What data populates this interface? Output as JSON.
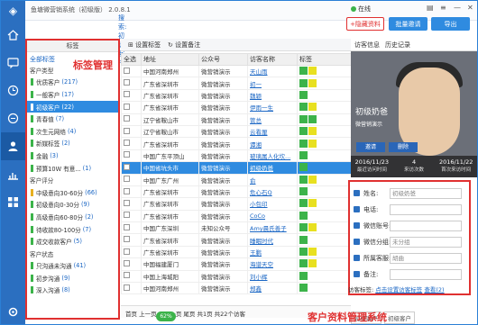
{
  "app": {
    "title": "鱼塘微营销系统（初级版） 2.0.8.1",
    "status": "在线",
    "search_text": "搜索: 初级客户"
  },
  "toolbar": {
    "collapse_label": "+隐藏资料",
    "batch_label": "批量邀请",
    "export_label": "导出"
  },
  "tag_panel": {
    "header": "标签",
    "all_tags": "全部标签",
    "annotation": "标签管理",
    "rows": [
      {
        "type": "cat",
        "label": "客户类型"
      },
      {
        "type": "tag",
        "label": "优质客户",
        "count": "(217)",
        "color": "#3cb34a"
      },
      {
        "type": "tag",
        "label": "一般客户",
        "count": "(17)",
        "color": "#3cb34a"
      },
      {
        "type": "tag",
        "label": "初级客户",
        "count": "(22)",
        "color": "#ffffff",
        "selected": true
      },
      {
        "type": "tag",
        "label": "青春值",
        "count": "(7)",
        "color": "#3cb34a"
      },
      {
        "type": "tag",
        "label": "次生元网络",
        "count": "(4)",
        "color": "#3cb34a"
      },
      {
        "type": "tag",
        "label": "新媒标签",
        "count": "(2)",
        "color": "#3cb34a"
      },
      {
        "type": "tag",
        "label": "金融",
        "count": "(3)",
        "color": "#3cb34a"
      },
      {
        "type": "tag",
        "label": "预算10W 有意...",
        "count": "(1)",
        "color": "#3cb34a"
      },
      {
        "type": "cat",
        "label": "客户评分"
      },
      {
        "type": "tag",
        "label": "中级意向30-60分",
        "count": "(66)",
        "color": "#e8b020"
      },
      {
        "type": "tag",
        "label": "初级意向0-30分",
        "count": "(9)",
        "color": "#3cb34a"
      },
      {
        "type": "tag",
        "label": "高级意向60-80分",
        "count": "(2)",
        "color": "#3cb34a"
      },
      {
        "type": "tag",
        "label": "待收款80-100分",
        "count": "(7)",
        "color": "#3cb34a"
      },
      {
        "type": "tag",
        "label": "成交收款客户",
        "count": "(5)",
        "color": "#3cb34a"
      },
      {
        "type": "cat",
        "label": "客户状态"
      },
      {
        "type": "tag",
        "label": "只沟通未沟通",
        "count": "(41)",
        "color": "#3cb34a"
      },
      {
        "type": "tag",
        "label": "初步沟通",
        "count": "(9)",
        "color": "#3cb34a"
      },
      {
        "type": "tag",
        "label": "深入沟通",
        "count": "(8)",
        "color": "#3cb34a"
      }
    ]
  },
  "grid": {
    "tool_set_tag": "设置标签",
    "tool_set_group": "设置备注",
    "columns": [
      "全选",
      "地址",
      "公众号",
      "访客名称",
      "标签"
    ],
    "rows": [
      {
        "addr": "中国河南郑州",
        "account": "微营销演示",
        "name": "天山雨",
        "tags": [
          "#3cb34a",
          "#e8e020"
        ]
      },
      {
        "addr": "广东省深圳市",
        "account": "微营销演示",
        "name": "初一",
        "tags": [
          "#3cb34a",
          "#e8e020"
        ]
      },
      {
        "addr": "广东省深圳市",
        "account": "微营销演示",
        "name": "魏颖",
        "tags": [
          "#3cb34a"
        ]
      },
      {
        "addr": "广东省深圳市",
        "account": "微营销演示",
        "name": "伊雨一生",
        "tags": [
          "#3cb34a",
          "#e8e020"
        ]
      },
      {
        "addr": "辽宁省鞍山市",
        "account": "微营销演示",
        "name": "管总",
        "tags": [
          "#3cb34a",
          "#3cb34a"
        ]
      },
      {
        "addr": "辽宁省鞍山市",
        "account": "微营销演示",
        "name": "云看厘",
        "tags": [
          "#3cb34a",
          "#e8e020"
        ]
      },
      {
        "addr": "广东省深圳市",
        "account": "微营销演示",
        "name": "谭湘",
        "tags": [
          "#3cb34a",
          "#e8e020"
        ]
      },
      {
        "addr": "中国广东平顶山",
        "account": "微营销演示",
        "name": "玻璃属人化坎...",
        "tags": [
          "#3cb34a"
        ]
      },
      {
        "addr": "中国省坑头市",
        "account": "微营销演示",
        "name": "初级奶爸",
        "tags": [
          "#3cb34a"
        ],
        "selected": true
      },
      {
        "addr": "中国广东广州",
        "account": "微营销演示",
        "name": "俞",
        "tags": [
          "#3cb34a",
          "#e8e020"
        ]
      },
      {
        "addr": "广东省深圳市",
        "account": "微营销演示",
        "name": "危心石Q",
        "tags": [
          "#3cb34a"
        ]
      },
      {
        "addr": "广东省深圳市",
        "account": "微营销演示",
        "name": "小包印",
        "tags": [
          "#3cb34a",
          "#e8e020"
        ]
      },
      {
        "addr": "广东省深圳市",
        "account": "微营销演示",
        "name": "CoCo",
        "tags": [
          "#3cb34a"
        ]
      },
      {
        "addr": "中国广东深圳",
        "account": "未知公众号",
        "name": "Amy晨氏善子",
        "tags": [
          "#3cb34a",
          "#e8e020"
        ]
      },
      {
        "addr": "广东省深圳市",
        "account": "微营销演示",
        "name": "睡眠时代",
        "tags": [
          "#3cb34a"
        ]
      },
      {
        "addr": "广东省深圳市",
        "account": "微营销演示",
        "name": "王鹏",
        "tags": [
          "#3cb34a",
          "#e8e020"
        ]
      },
      {
        "addr": "中国福建厦门",
        "account": "微营销演示",
        "name": "海谱天空",
        "tags": [
          "#3cb34a",
          "#e8e020"
        ]
      },
      {
        "addr": "中国上海城阳",
        "account": "微营销演示",
        "name": "刘小辉",
        "tags": [
          "#3cb34a"
        ]
      },
      {
        "addr": "中国河南郑州",
        "account": "微营销演示",
        "name": "郑鑫",
        "tags": [
          "#3cb34a"
        ]
      }
    ]
  },
  "pager": {
    "text": "首页 上一页 1 下一页 尾页 共1页 共22个访客",
    "percent": "62%"
  },
  "right": {
    "tab_info": "访客信息",
    "tab_history": "历史记录",
    "profile_name": "初级奶爸",
    "profile_sub": "微营销演示",
    "btn_invite": "邀请",
    "btn_delete": "删除",
    "stats": [
      {
        "value": "2016/11/23",
        "label": "最近访问时间"
      },
      {
        "value": "4",
        "label": "来访次数"
      },
      {
        "value": "2016/11/22",
        "label": "首次来访时间"
      }
    ],
    "form": [
      {
        "label": "姓名:",
        "value": "初级奶爸"
      },
      {
        "label": "电话:",
        "value": ""
      },
      {
        "label": "微信账号:",
        "value": ""
      },
      {
        "label": "微信分组:",
        "value": "未分组"
      },
      {
        "label": "所属客服:",
        "value": "胡曲"
      },
      {
        "label": "备注:",
        "value": ""
      }
    ],
    "tag_label": "访客标签:",
    "tag_link": "点击设置访客标签",
    "tag_more": "查看(2)",
    "bottom_tags": [
      "初级客户",
      "初级客户"
    ],
    "annotation": "客户资料管理系统"
  }
}
